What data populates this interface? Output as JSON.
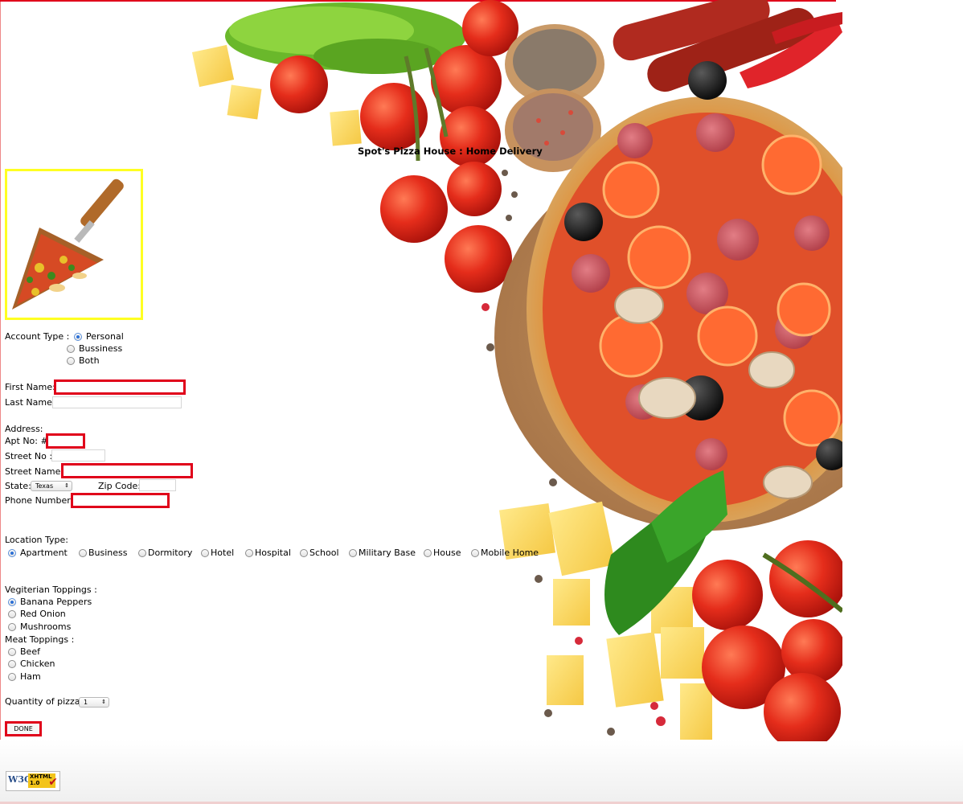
{
  "page": {
    "title": "Spot's Pizza House : Home Delivery"
  },
  "account_type": {
    "label": "Account Type :",
    "options": [
      "Personal",
      "Bussiness",
      "Both"
    ],
    "selected": "Personal"
  },
  "name": {
    "first_label": "First Name:",
    "last_label": "Last Name:"
  },
  "address": {
    "heading": "Address:",
    "apt_label": "Apt No: #",
    "street_no_label": "Street No :",
    "street_name_label": "Street Name:",
    "state_label": "State:",
    "state_value": "Texas",
    "zip_label": "Zip Code:",
    "phone_label": "Phone Number:"
  },
  "location_type": {
    "label": "Location Type:",
    "options": [
      "Apartment",
      "Business",
      "Dormitory",
      "Hotel",
      "Hospital",
      "School",
      "Military Base",
      "House",
      "Mobile Home"
    ],
    "selected": "Apartment"
  },
  "veg_toppings": {
    "label": "Vegiterian Toppings :",
    "options": [
      "Banana Peppers",
      "Red Onion",
      "Mushrooms"
    ],
    "selected": "Banana Peppers"
  },
  "meat_toppings": {
    "label": "Meat Toppings :",
    "options": [
      "Beef",
      "Chicken",
      "Ham"
    ]
  },
  "quantity": {
    "label": "Quantity of pizzas",
    "value": "1"
  },
  "done_label": "DONE",
  "badge": {
    "w3c": "W3C",
    "line1": "XHTML",
    "line2": "1.0"
  },
  "colors": {
    "highlight_border": "#e0001a",
    "thumb_border": "#ffff22",
    "radio_selected": "#2b6fd6"
  }
}
